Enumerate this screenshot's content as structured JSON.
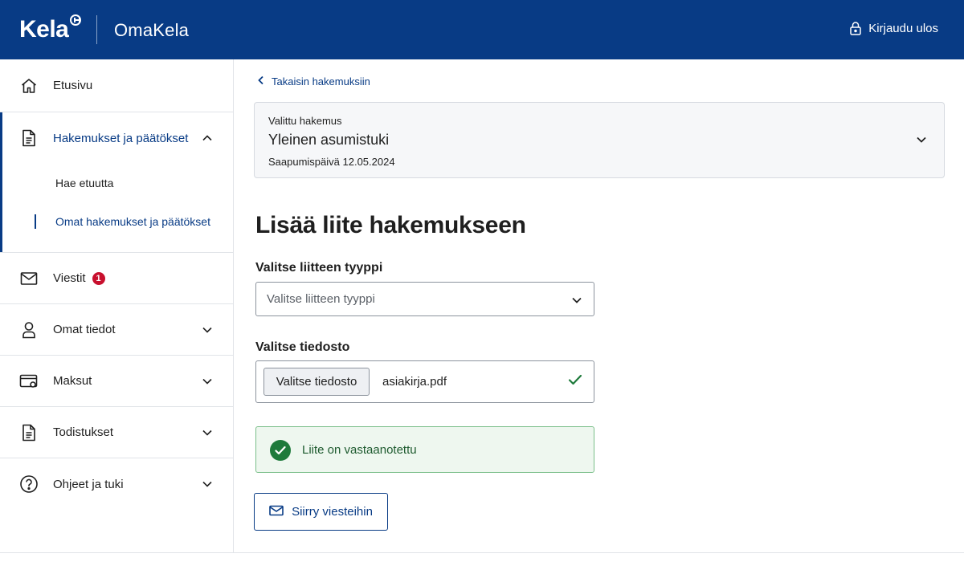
{
  "header": {
    "logo_text": "Kela",
    "app_name": "OmaKela",
    "logout_label": "Kirjaudu ulos"
  },
  "sidebar": {
    "items": [
      {
        "label": "Etusivu",
        "icon": "home-icon"
      },
      {
        "label": "Hakemukset ja päätökset",
        "icon": "document-icon",
        "expanded": true,
        "children": [
          {
            "label": "Hae etuutta"
          },
          {
            "label": "Omat hakemukset ja päätökset",
            "active": true
          }
        ]
      },
      {
        "label": "Viestit",
        "icon": "mail-icon",
        "badge": "1"
      },
      {
        "label": "Omat tiedot",
        "icon": "person-icon"
      },
      {
        "label": "Maksut",
        "icon": "wallet-icon"
      },
      {
        "label": "Todistukset",
        "icon": "certificate-icon"
      },
      {
        "label": "Ohjeet ja tuki",
        "icon": "help-icon"
      }
    ]
  },
  "main": {
    "back_link": "Takaisin hakemuksiin",
    "selected_application": {
      "caption": "Valittu hakemus",
      "title": "Yleinen asumistuki",
      "date": "Saapumispäivä 12.05.2024"
    },
    "page_title": "Lisää liite hakemukseen",
    "type_field": {
      "label": "Valitse liitteen tyyppi",
      "placeholder": "Valitse liitteen tyyppi"
    },
    "file_field": {
      "label": "Valitse tiedosto",
      "button_label": "Valitse tiedosto",
      "file_name": "asiakirja.pdf"
    },
    "success_message": "Liite on vastaanotettu",
    "go_to_messages_button": "Siirry viesteihin"
  },
  "colors": {
    "brand": "#083b85",
    "badge": "#c8102e",
    "success": "#1e7a3b"
  }
}
